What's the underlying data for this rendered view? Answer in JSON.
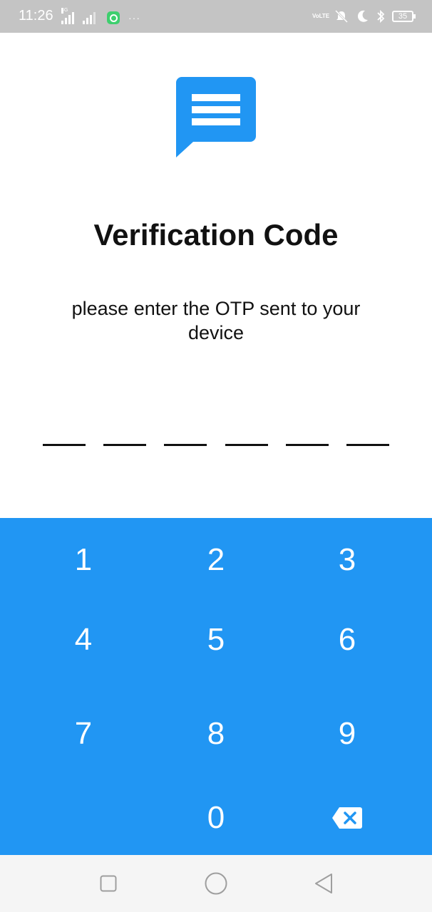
{
  "status_bar": {
    "time": "11:26",
    "signal_label": "4G",
    "volte_label": "VoLTE",
    "battery": "35"
  },
  "logo": {
    "icon": "message-icon",
    "color": "#2196f3"
  },
  "title": "Verification Code",
  "subtitle": "please enter the OTP sent to your device",
  "otp": {
    "length": 6,
    "digits": [
      "",
      "",
      "",
      "",
      "",
      ""
    ]
  },
  "keypad": {
    "background": "#2196f3",
    "keys": [
      "1",
      "2",
      "3",
      "4",
      "5",
      "6",
      "7",
      "8",
      "9",
      "0"
    ],
    "backspace_icon": "backspace-icon"
  },
  "nav": {
    "icons": [
      "recent-apps-icon",
      "home-icon",
      "back-icon"
    ]
  }
}
